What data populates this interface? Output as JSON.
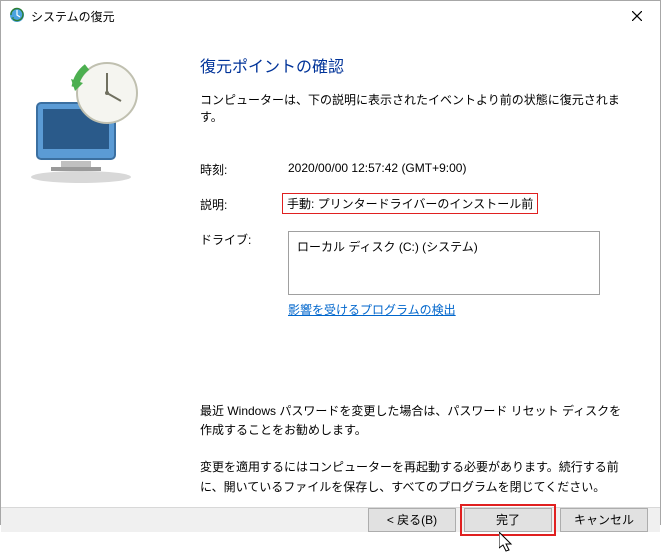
{
  "titlebar": {
    "title": "システムの復元"
  },
  "main": {
    "heading": "復元ポイントの確認",
    "intro": "コンピューターは、下の説明に表示されたイベントより前の状態に復元されます。",
    "time_label": "時刻:",
    "time_value": "2020/00/00 12:57:42 (GMT+9:00)",
    "desc_label": "説明:",
    "desc_value": "手動: プリンタードライバーのインストール前",
    "drive_label": "ドライブ:",
    "drive_value": "ローカル ディスク (C:) (システム)",
    "scan_link": "影響を受けるプログラムの検出",
    "note1": "最近 Windows パスワードを変更した場合は、パスワード リセット ディスクを作成することをお勧めします。",
    "note2": "変更を適用するにはコンピューターを再起動する必要があります。続行する前に、開いているファイルを保存し、すべてのプログラムを閉じてください。"
  },
  "footer": {
    "back": "< 戻る(B)",
    "finish": "完了",
    "cancel": "キャンセル"
  }
}
